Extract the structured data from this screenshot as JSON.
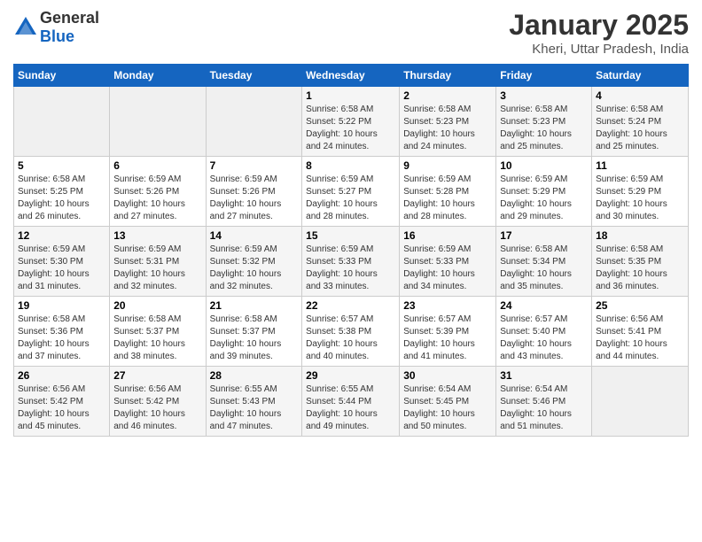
{
  "header": {
    "logo_general": "General",
    "logo_blue": "Blue",
    "month_title": "January 2025",
    "location": "Kheri, Uttar Pradesh, India"
  },
  "weekdays": [
    "Sunday",
    "Monday",
    "Tuesday",
    "Wednesday",
    "Thursday",
    "Friday",
    "Saturday"
  ],
  "weeks": [
    [
      {
        "day": "",
        "info": ""
      },
      {
        "day": "",
        "info": ""
      },
      {
        "day": "",
        "info": ""
      },
      {
        "day": "1",
        "info": "Sunrise: 6:58 AM\nSunset: 5:22 PM\nDaylight: 10 hours\nand 24 minutes."
      },
      {
        "day": "2",
        "info": "Sunrise: 6:58 AM\nSunset: 5:23 PM\nDaylight: 10 hours\nand 24 minutes."
      },
      {
        "day": "3",
        "info": "Sunrise: 6:58 AM\nSunset: 5:23 PM\nDaylight: 10 hours\nand 25 minutes."
      },
      {
        "day": "4",
        "info": "Sunrise: 6:58 AM\nSunset: 5:24 PM\nDaylight: 10 hours\nand 25 minutes."
      }
    ],
    [
      {
        "day": "5",
        "info": "Sunrise: 6:58 AM\nSunset: 5:25 PM\nDaylight: 10 hours\nand 26 minutes."
      },
      {
        "day": "6",
        "info": "Sunrise: 6:59 AM\nSunset: 5:26 PM\nDaylight: 10 hours\nand 27 minutes."
      },
      {
        "day": "7",
        "info": "Sunrise: 6:59 AM\nSunset: 5:26 PM\nDaylight: 10 hours\nand 27 minutes."
      },
      {
        "day": "8",
        "info": "Sunrise: 6:59 AM\nSunset: 5:27 PM\nDaylight: 10 hours\nand 28 minutes."
      },
      {
        "day": "9",
        "info": "Sunrise: 6:59 AM\nSunset: 5:28 PM\nDaylight: 10 hours\nand 28 minutes."
      },
      {
        "day": "10",
        "info": "Sunrise: 6:59 AM\nSunset: 5:29 PM\nDaylight: 10 hours\nand 29 minutes."
      },
      {
        "day": "11",
        "info": "Sunrise: 6:59 AM\nSunset: 5:29 PM\nDaylight: 10 hours\nand 30 minutes."
      }
    ],
    [
      {
        "day": "12",
        "info": "Sunrise: 6:59 AM\nSunset: 5:30 PM\nDaylight: 10 hours\nand 31 minutes."
      },
      {
        "day": "13",
        "info": "Sunrise: 6:59 AM\nSunset: 5:31 PM\nDaylight: 10 hours\nand 32 minutes."
      },
      {
        "day": "14",
        "info": "Sunrise: 6:59 AM\nSunset: 5:32 PM\nDaylight: 10 hours\nand 32 minutes."
      },
      {
        "day": "15",
        "info": "Sunrise: 6:59 AM\nSunset: 5:33 PM\nDaylight: 10 hours\nand 33 minutes."
      },
      {
        "day": "16",
        "info": "Sunrise: 6:59 AM\nSunset: 5:33 PM\nDaylight: 10 hours\nand 34 minutes."
      },
      {
        "day": "17",
        "info": "Sunrise: 6:58 AM\nSunset: 5:34 PM\nDaylight: 10 hours\nand 35 minutes."
      },
      {
        "day": "18",
        "info": "Sunrise: 6:58 AM\nSunset: 5:35 PM\nDaylight: 10 hours\nand 36 minutes."
      }
    ],
    [
      {
        "day": "19",
        "info": "Sunrise: 6:58 AM\nSunset: 5:36 PM\nDaylight: 10 hours\nand 37 minutes."
      },
      {
        "day": "20",
        "info": "Sunrise: 6:58 AM\nSunset: 5:37 PM\nDaylight: 10 hours\nand 38 minutes."
      },
      {
        "day": "21",
        "info": "Sunrise: 6:58 AM\nSunset: 5:37 PM\nDaylight: 10 hours\nand 39 minutes."
      },
      {
        "day": "22",
        "info": "Sunrise: 6:57 AM\nSunset: 5:38 PM\nDaylight: 10 hours\nand 40 minutes."
      },
      {
        "day": "23",
        "info": "Sunrise: 6:57 AM\nSunset: 5:39 PM\nDaylight: 10 hours\nand 41 minutes."
      },
      {
        "day": "24",
        "info": "Sunrise: 6:57 AM\nSunset: 5:40 PM\nDaylight: 10 hours\nand 43 minutes."
      },
      {
        "day": "25",
        "info": "Sunrise: 6:56 AM\nSunset: 5:41 PM\nDaylight: 10 hours\nand 44 minutes."
      }
    ],
    [
      {
        "day": "26",
        "info": "Sunrise: 6:56 AM\nSunset: 5:42 PM\nDaylight: 10 hours\nand 45 minutes."
      },
      {
        "day": "27",
        "info": "Sunrise: 6:56 AM\nSunset: 5:42 PM\nDaylight: 10 hours\nand 46 minutes."
      },
      {
        "day": "28",
        "info": "Sunrise: 6:55 AM\nSunset: 5:43 PM\nDaylight: 10 hours\nand 47 minutes."
      },
      {
        "day": "29",
        "info": "Sunrise: 6:55 AM\nSunset: 5:44 PM\nDaylight: 10 hours\nand 49 minutes."
      },
      {
        "day": "30",
        "info": "Sunrise: 6:54 AM\nSunset: 5:45 PM\nDaylight: 10 hours\nand 50 minutes."
      },
      {
        "day": "31",
        "info": "Sunrise: 6:54 AM\nSunset: 5:46 PM\nDaylight: 10 hours\nand 51 minutes."
      },
      {
        "day": "",
        "info": ""
      }
    ]
  ]
}
